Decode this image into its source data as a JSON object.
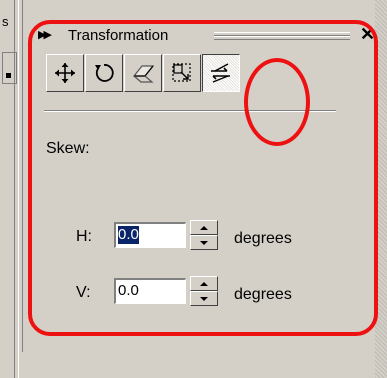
{
  "edge": {
    "left_label": "s"
  },
  "panel": {
    "title": "Transformation",
    "close_glyph": "✕"
  },
  "toolbar": {
    "tools": [
      {
        "name": "position",
        "icon": "move-arrows-icon"
      },
      {
        "name": "rotate",
        "icon": "rotate-icon"
      },
      {
        "name": "scale-mirror",
        "icon": "mirror-icon"
      },
      {
        "name": "size",
        "icon": "size-icon"
      },
      {
        "name": "skew",
        "icon": "skew-icon",
        "active": true
      }
    ]
  },
  "skew": {
    "section_label": "Skew:",
    "h_label": "H:",
    "h_value": "0.0",
    "v_label": "V:",
    "v_value": "0.0",
    "unit": "degrees"
  },
  "annotations": {
    "color": "#ee1111"
  }
}
